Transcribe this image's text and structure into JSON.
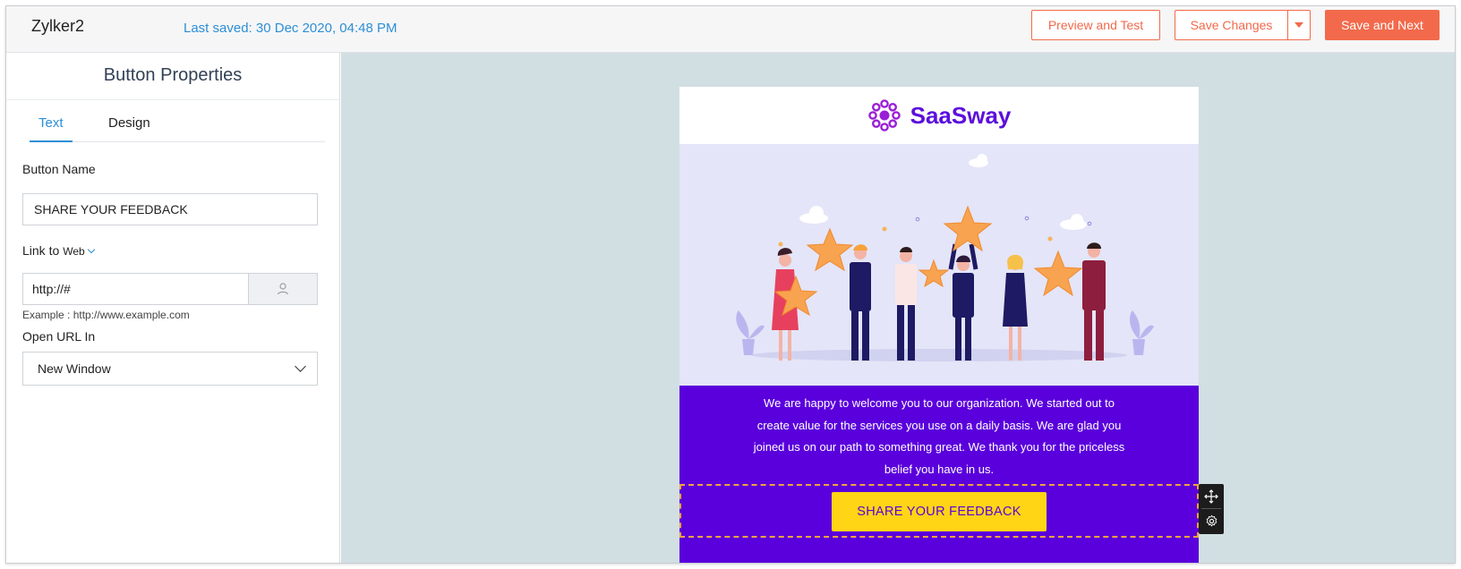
{
  "header": {
    "app_name": "Zylker2",
    "last_saved": "Last saved: 30 Dec 2020, 04:48 PM",
    "preview_label": "Preview and Test",
    "save_label": "Save Changes",
    "next_label": "Save and Next",
    "accent_color": "#f26a4b"
  },
  "panel": {
    "title": "Button Properties",
    "tabs": [
      {
        "label": "Text",
        "active": true
      },
      {
        "label": "Design",
        "active": false
      }
    ],
    "button_name_label": "Button Name",
    "button_name_value": "SHARE YOUR FEEDBACK",
    "link_to_label": "Link to",
    "link_to_value": "Web",
    "url_value": "http://#",
    "url_example": "Example : http://www.example.com",
    "open_url_label": "Open URL In",
    "open_url_value": "New Window"
  },
  "email": {
    "brand_name": "SaaSway",
    "brand_color": "#5b0fdc",
    "welcome_text": "We are happy to welcome you to our organization. We started out to create value for the services you use on a daily basis. We are glad you joined us on our path to something great. We thank you for the priceless belief you have in us.",
    "cta_label": "SHARE YOUR FEEDBACK",
    "cta_color": "#ffd515",
    "section_color": "#5a00dc"
  },
  "icons": {
    "move": "move-arrows-icon",
    "settings": "gear-icon",
    "user": "user-icon",
    "logo": "flower-logo-icon"
  }
}
